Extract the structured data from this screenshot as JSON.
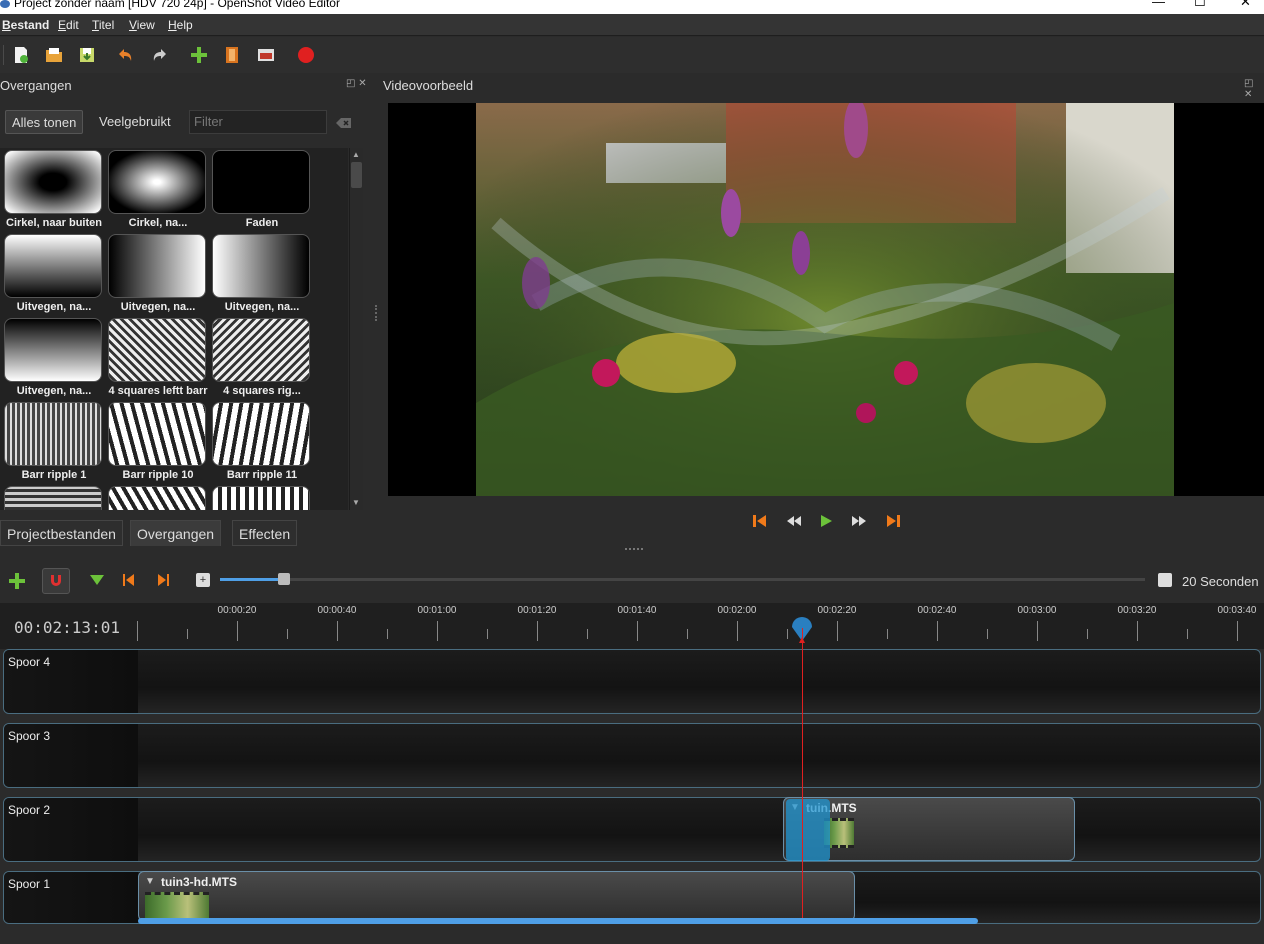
{
  "window": {
    "title": "Project zonder naam [HDV 720 24p] - OpenShot Video Editor",
    "minimize": "—",
    "maximize": "☐",
    "close": "✕"
  },
  "menu": [
    "Bestand",
    "Edit",
    "Titel",
    "View",
    "Help"
  ],
  "transitions_panel": {
    "title": "Overgangen",
    "show_all": "Alles tonen",
    "common": "Veelgebruikt",
    "filter_placeholder": "Filter",
    "items": [
      "Cirkel, naar buiten",
      "Cirkel, na...",
      "Faden",
      "Uitvegen, na...",
      "Uitvegen, na...",
      "Uitvegen, na...",
      "Uitvegen, na...",
      "4 squares leftt barr",
      "4 squares rig...",
      "Barr ripple 1",
      "Barr ripple 10",
      "Barr ripple 11"
    ]
  },
  "tabs": [
    "Projectbestanden",
    "Overgangen",
    "Effecten"
  ],
  "preview": {
    "title": "Videovoorbeeld"
  },
  "timeline": {
    "zoom_label": "20 Seconden",
    "timecode": "00:02:13:01",
    "ruler_labels": [
      "00:00:20",
      "00:00:40",
      "00:01:00",
      "00:01:20",
      "00:01:40",
      "00:02:00",
      "00:02:20",
      "00:02:40",
      "00:03:00",
      "00:03:20",
      "00:03:40"
    ],
    "tracks": [
      "Spoor 4",
      "Spoor 3",
      "Spoor 2",
      "Spoor 1"
    ],
    "clips": {
      "track2": "tuin.MTS",
      "track1": "tuin3-hd.MTS"
    }
  },
  "colors": {
    "accent": "#4f9fe6",
    "playhead": "#e02020",
    "record": "#e02020"
  }
}
